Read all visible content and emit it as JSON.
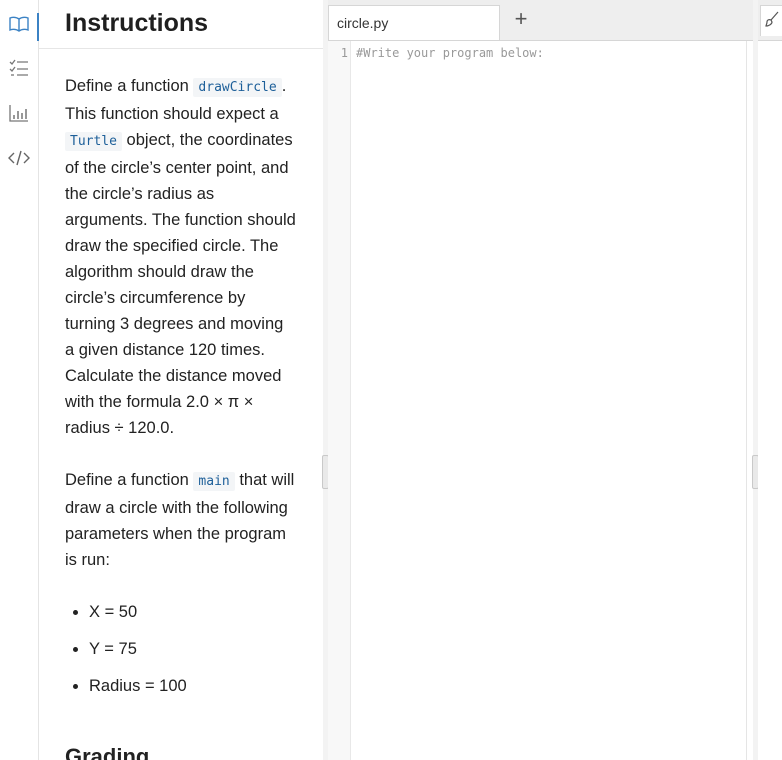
{
  "instructions": {
    "title": "Instructions",
    "p1": {
      "t1": "Define a function ",
      "c1": "drawCircle",
      "t2": ". This function should expect a ",
      "c2": "Turtle",
      "t3": " object, the coordinates of the circle’s center point, and the circle’s radius as arguments. The function should draw the specified circle. The algorithm should draw the circle’s circumference by turning 3 degrees and moving a given distance 120 times. Calculate the distance moved with the formula 2.0 × π × radius ÷ 120.0."
    },
    "p2": {
      "t1": "Define a function ",
      "c1": "main",
      "t2": " that will draw a circle with the following parameters when the program is run:"
    },
    "params": [
      "X = 50",
      "Y = 75",
      "Radius = 100"
    ],
    "next_heading": "Grading"
  },
  "editor": {
    "tab_label": "circle.py",
    "add_tab_label": "+",
    "line_numbers": [
      "1"
    ],
    "code": "#Write your program below:"
  },
  "rail": {
    "icons": [
      "book-icon",
      "checklist-icon",
      "bar-chart-icon",
      "code-icon"
    ],
    "accent": "#3b82c4"
  }
}
